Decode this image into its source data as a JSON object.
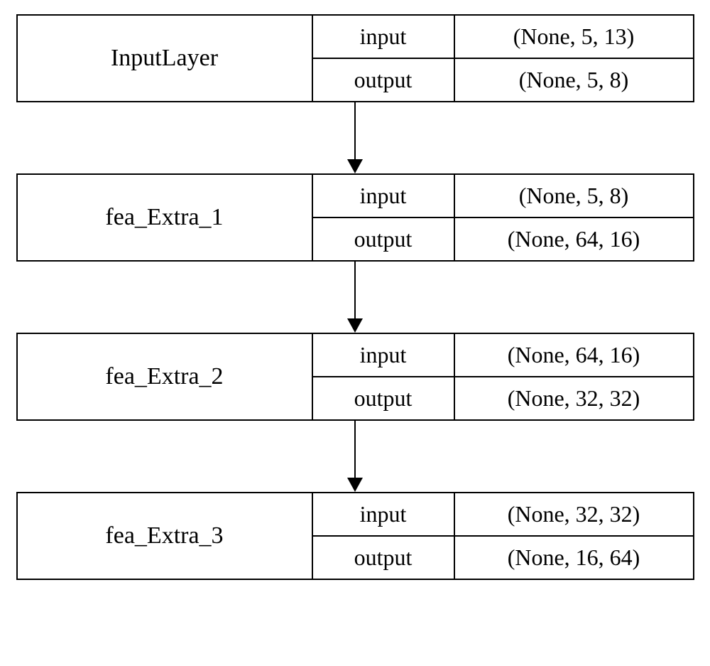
{
  "labels": {
    "input": "input",
    "output": "output"
  },
  "layers": [
    {
      "name": "InputLayer",
      "input": "(None, 5, 13)",
      "output": "(None, 5, 8)"
    },
    {
      "name": "fea_Extra_1",
      "input": "(None, 5, 8)",
      "output": "(None, 64, 16)"
    },
    {
      "name": "fea_Extra_2",
      "input": "(None, 64, 16)",
      "output": "(None, 32, 32)"
    },
    {
      "name": "fea_Extra_3",
      "input": "(None, 32, 32)",
      "output": "(None, 16, 64)"
    }
  ],
  "chart_data": {
    "type": "table",
    "title": "",
    "columns": [
      "layer",
      "input_shape",
      "output_shape"
    ],
    "rows": [
      [
        "InputLayer",
        "(None, 5, 13)",
        "(None, 5, 8)"
      ],
      [
        "fea_Extra_1",
        "(None, 5, 8)",
        "(None, 64, 16)"
      ],
      [
        "fea_Extra_2",
        "(None, 64, 16)",
        "(None, 32, 32)"
      ],
      [
        "fea_Extra_3",
        "(None, 32, 32)",
        "(None, 16, 64)"
      ]
    ]
  }
}
